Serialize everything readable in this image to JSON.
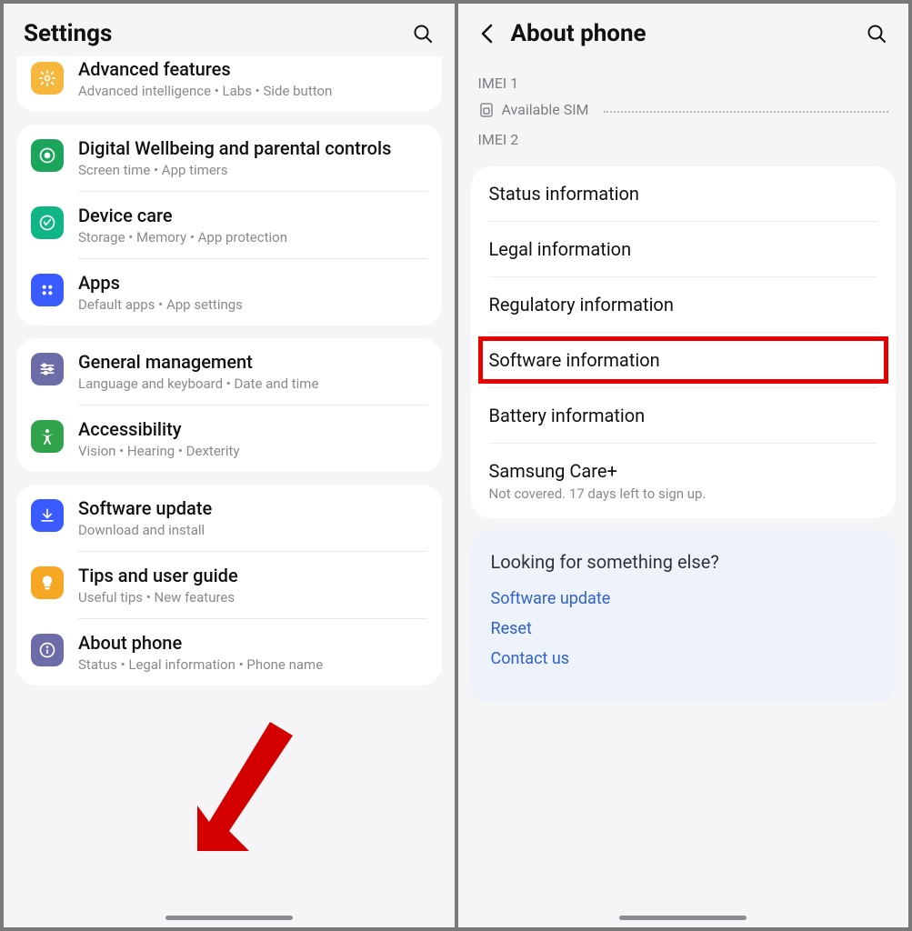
{
  "left": {
    "title": "Settings",
    "groups": [
      {
        "clipped": true,
        "items": [
          {
            "icon": "adv",
            "color": "#f5b83d",
            "title": "Advanced features",
            "sub": "Advanced intelligence  •  Labs  •  Side button"
          }
        ]
      },
      {
        "items": [
          {
            "icon": "wellbeing",
            "color": "#1aa55a",
            "title": "Digital Wellbeing and parental controls",
            "sub": "Screen time  •  App timers"
          },
          {
            "icon": "devicecare",
            "color": "#10b585",
            "title": "Device care",
            "sub": "Storage  •  Memory  •  App protection"
          },
          {
            "icon": "apps",
            "color": "#3a5bff",
            "title": "Apps",
            "sub": "Default apps  •  App settings"
          }
        ]
      },
      {
        "items": [
          {
            "icon": "general",
            "color": "#6c6ca8",
            "title": "General management",
            "sub": "Language and keyboard  •  Date and time"
          },
          {
            "icon": "accessibility",
            "color": "#2fa24a",
            "title": "Accessibility",
            "sub": "Vision  •  Hearing  •  Dexterity"
          }
        ]
      },
      {
        "items": [
          {
            "icon": "update",
            "color": "#3a5bff",
            "title": "Software update",
            "sub": "Download and install"
          },
          {
            "icon": "tips",
            "color": "#f5a623",
            "title": "Tips and user guide",
            "sub": "Useful tips  •  New features"
          },
          {
            "icon": "about",
            "color": "#6c6ca8",
            "title": "About phone",
            "sub": "Status  •  Legal information  •  Phone name"
          }
        ]
      }
    ]
  },
  "right": {
    "title": "About phone",
    "imei1": "IMEI 1",
    "sim": "Available SIM",
    "imei2": "IMEI 2",
    "list": [
      {
        "title": "Status information",
        "highlight": false
      },
      {
        "title": "Legal information",
        "highlight": false
      },
      {
        "title": "Regulatory information",
        "highlight": false
      },
      {
        "title": "Software information",
        "highlight": true
      },
      {
        "title": "Battery information",
        "highlight": false
      },
      {
        "title": "Samsung Care+",
        "sub": "Not covered. 17 days left to sign up.",
        "highlight": false
      }
    ],
    "suggest": {
      "title": "Looking for something else?",
      "links": [
        "Software update",
        "Reset",
        "Contact us"
      ]
    }
  }
}
